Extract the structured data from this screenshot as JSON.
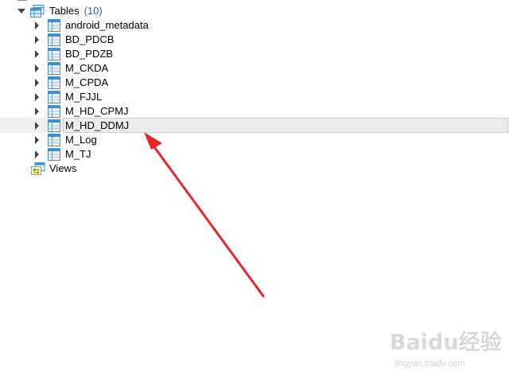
{
  "tree": {
    "tables_group": {
      "label": "Tables",
      "count": "(10)"
    },
    "tables": [
      {
        "label": "android_metadata"
      },
      {
        "label": "BD_PDCB"
      },
      {
        "label": "BD_PDZB"
      },
      {
        "label": "M_CKDA"
      },
      {
        "label": "M_CPDA"
      },
      {
        "label": "M_FJJL"
      },
      {
        "label": "M_HD_CPMJ"
      },
      {
        "label": "M_HD_DDMJ",
        "selected": true
      },
      {
        "label": "M_Log"
      },
      {
        "label": "M_TJ"
      }
    ],
    "views_group": {
      "label": "Views"
    }
  },
  "annotation": {
    "arrow_color": "#e8242b"
  },
  "watermark": {
    "logo": "Baidu经验",
    "url": "jingyan.baidu.com"
  },
  "colors": {
    "count": "#1f5fd6",
    "selection_bg": "#ececec",
    "table_icon": "#3d8fd6"
  }
}
